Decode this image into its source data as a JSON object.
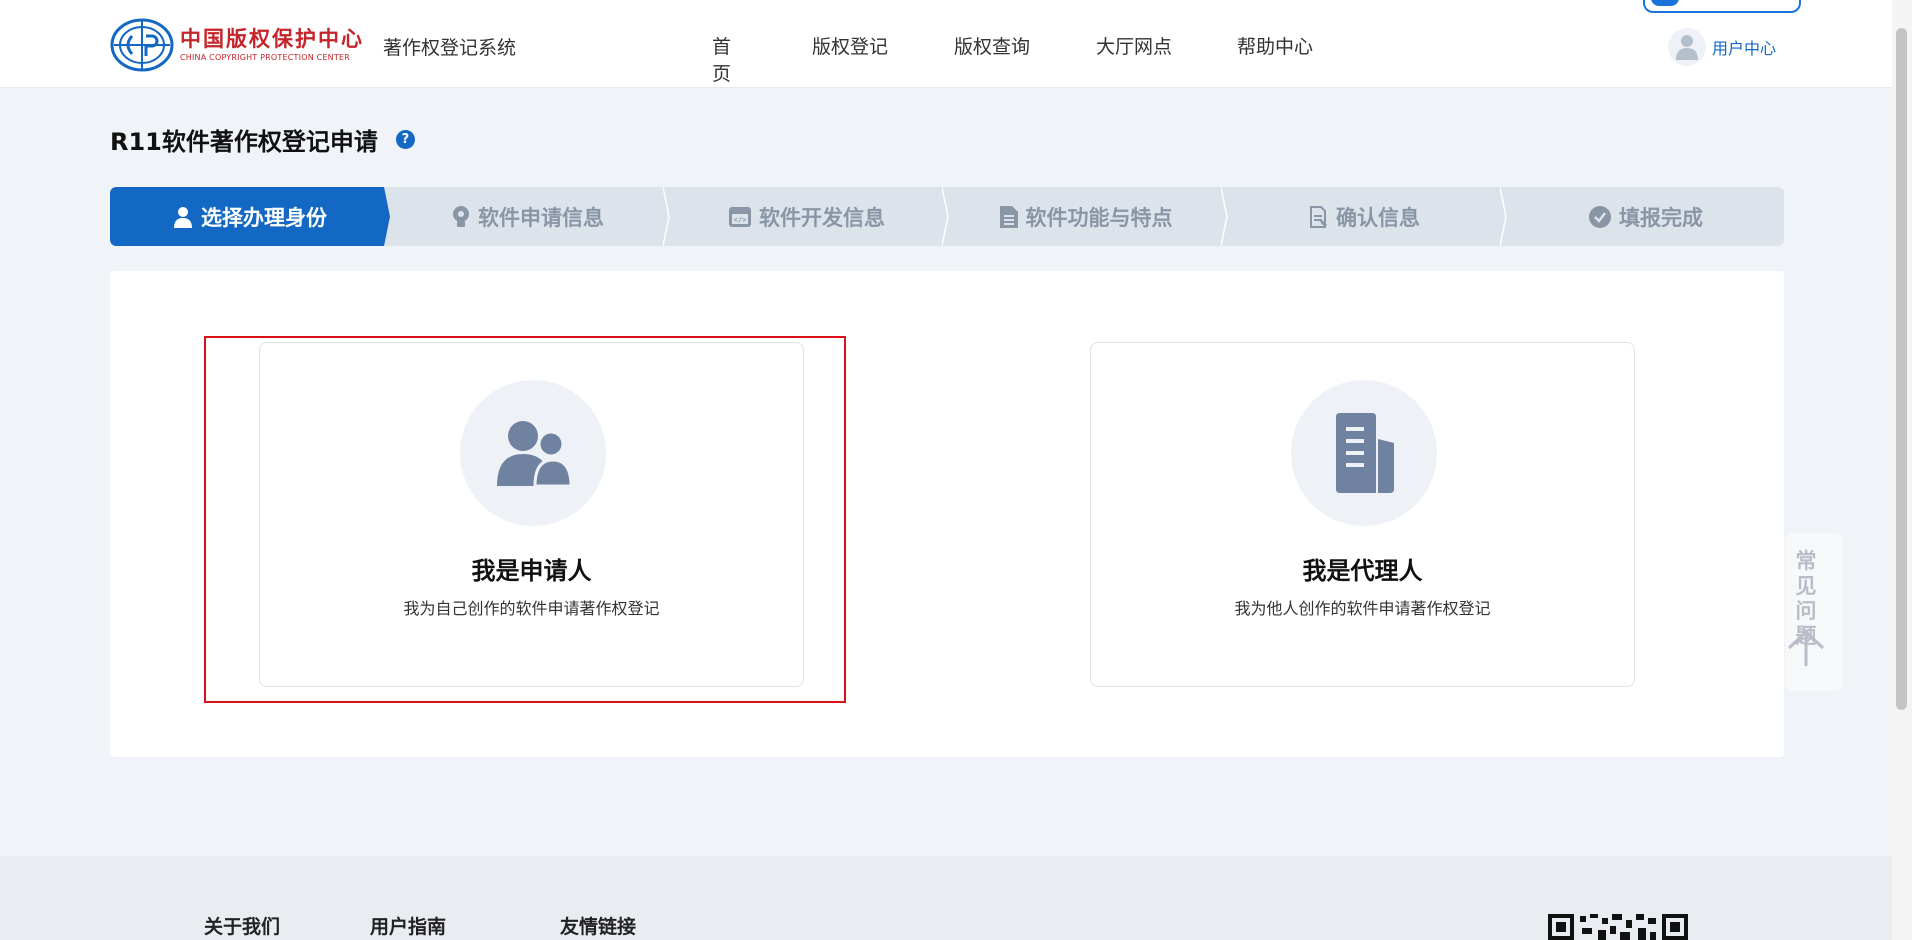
{
  "header": {
    "logo_cn": "中国版权保护中心",
    "logo_en": "CHINA COPYRIGHT PROTECTION CENTER",
    "system_name": "著作权登记系统",
    "nav": [
      "首页",
      "版权登记",
      "版权查询",
      "大厅网点",
      "帮助中心"
    ],
    "user_center": "用户中心"
  },
  "page": {
    "title": "R11软件著作权登记申请",
    "help_icon": "help-circle-icon"
  },
  "steps": [
    {
      "label": "选择办理身份",
      "icon": "user-icon",
      "active": true
    },
    {
      "label": "软件申请信息",
      "icon": "bulb-icon",
      "active": false
    },
    {
      "label": "软件开发信息",
      "icon": "code-window-icon",
      "active": false
    },
    {
      "label": "软件功能与特点",
      "icon": "document-icon",
      "active": false
    },
    {
      "label": "确认信息",
      "icon": "file-edit-icon",
      "active": false
    },
    {
      "label": "填报完成",
      "icon": "check-circle-icon",
      "active": false
    }
  ],
  "cards": {
    "applicant": {
      "title": "我是申请人",
      "desc": "我为自己创作的软件申请著作权登记",
      "icon": "users-icon"
    },
    "agent": {
      "title": "我是代理人",
      "desc": "我为他人创作的软件申请著作权登记",
      "icon": "documents-icon"
    }
  },
  "float": {
    "faq": "常见\n问题",
    "back_top": "arrow-up-icon"
  },
  "footer": {
    "links": [
      "关于我们",
      "用户指南",
      "友情链接"
    ]
  },
  "colors": {
    "primary": "#1368c4",
    "brand_red": "#c5242a",
    "highlight": "#d8111b"
  }
}
